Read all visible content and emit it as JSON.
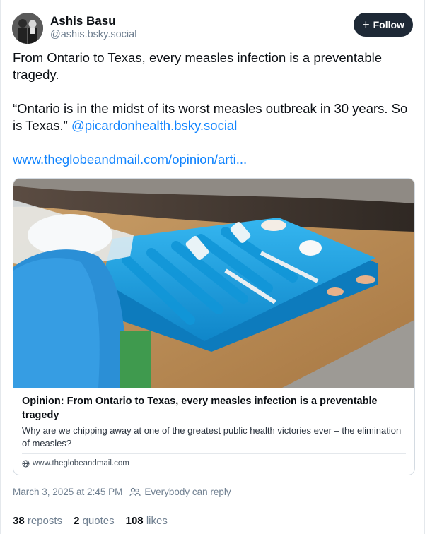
{
  "author": {
    "name": "Ashis Basu",
    "handle": "@ashis.bsky.social"
  },
  "follow_label": "Follow",
  "post": {
    "line1": "From Ontario to Texas, every measles infection is a preventable tragedy.",
    "quote": "“Ontario is in the midst of its worst measles outbreak in 30 years. So is Texas.”",
    "mention": "@picardonhealth.bsky.social",
    "link": "www.theglobeandmail.com/opinion/arti..."
  },
  "card": {
    "title": "Opinion: From Ontario to Texas, every measles infection is a preventable tragedy",
    "description": "Why are we chipping away at one of the greatest public health victories ever – the elimination of measles?",
    "domain": "www.theglobeandmail.com"
  },
  "meta": {
    "timestamp": "March 3, 2025 at 2:45 PM",
    "reply_setting": "Everybody can reply"
  },
  "stats": {
    "reposts_count": "38",
    "reposts_label": "reposts",
    "quotes_count": "2",
    "quotes_label": "quotes",
    "likes_count": "108",
    "likes_label": "likes"
  },
  "colors": {
    "link": "#1083fe",
    "follow_bg": "#1e2936",
    "tray": "#1aa6e8"
  }
}
